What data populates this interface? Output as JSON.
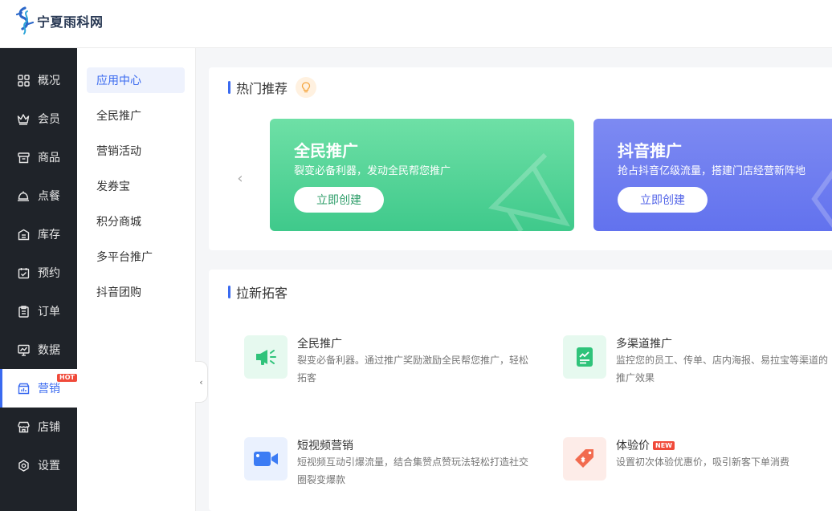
{
  "brand": {
    "name": "宁夏雨科网"
  },
  "sidebar": {
    "items": [
      {
        "label": "概况",
        "icon": "grid-icon"
      },
      {
        "label": "会员",
        "icon": "crown-icon"
      },
      {
        "label": "商品",
        "icon": "shop-box-icon"
      },
      {
        "label": "点餐",
        "icon": "dish-cover-icon"
      },
      {
        "label": "库存",
        "icon": "inventory-icon"
      },
      {
        "label": "预约",
        "icon": "calendar-check-icon"
      },
      {
        "label": "订单",
        "icon": "clipboard-icon"
      },
      {
        "label": "数据",
        "icon": "chart-screen-icon"
      },
      {
        "label": "营销",
        "icon": "marketing-icon",
        "badge": "HOT",
        "active": true
      },
      {
        "label": "店铺",
        "icon": "store-icon"
      },
      {
        "label": "设置",
        "icon": "settings-icon"
      }
    ]
  },
  "submenu": {
    "items": [
      {
        "label": "应用中心",
        "active": true
      },
      {
        "label": "全民推广"
      },
      {
        "label": "营销活动"
      },
      {
        "label": "发券宝"
      },
      {
        "label": "积分商城"
      },
      {
        "label": "多平台推广"
      },
      {
        "label": "抖音团购"
      }
    ]
  },
  "hot_section": {
    "title": "热门推荐",
    "banners": [
      {
        "title": "全民推广",
        "desc": "裂变必备利器，发动全民帮您推广",
        "button": "立即创建"
      },
      {
        "title": "抖音推广",
        "desc": "抢占抖音亿级流量，搭建门店经营新阵地",
        "button": "立即创建"
      }
    ]
  },
  "new_section": {
    "title": "拉新拓客",
    "features": [
      {
        "title": "全民推广",
        "desc": "裂变必备利器。通过推广奖励激励全民帮您推广，轻松拓客",
        "icon": "megaphone-icon"
      },
      {
        "title": "多渠道推广",
        "desc": "监控您的员工、传单、店内海报、易拉宝等渠道的推广效果",
        "icon": "report-icon"
      },
      {
        "title": "短视频营销",
        "desc": "短视频互动引爆流量，结合集赞点赞玩法轻松打造社交圈裂变爆款",
        "icon": "video-camera-icon"
      },
      {
        "title": "体验价",
        "badge": "NEW",
        "desc": "设置初次体验优惠价，吸引新客下单消费",
        "icon": "price-tag-icon"
      }
    ]
  },
  "colors": {
    "accent": "#3a6af0",
    "sidebar_bg": "#1f2329",
    "green_banner": "#4cd394",
    "purple_banner": "#6e7cf0"
  }
}
